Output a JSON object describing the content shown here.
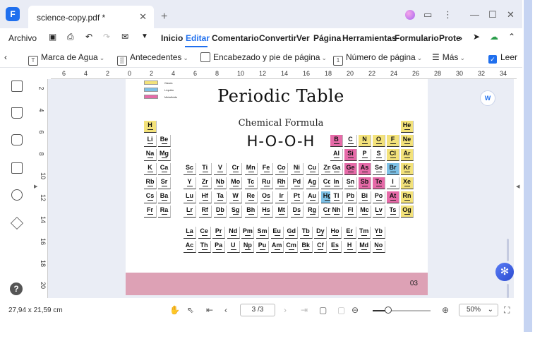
{
  "window": {
    "tab_title": "science-copy.pdf *",
    "close_glyph": "✕",
    "new_tab_glyph": "+",
    "controls": [
      "⋮",
      "—",
      "☐",
      "✕"
    ]
  },
  "menu": {
    "file": "Archivo",
    "items": [
      "Inicio",
      "Editar",
      "Comentario",
      "Convertir",
      "Ver",
      "Página",
      "Herramientas",
      "Formulario",
      "Prote"
    ],
    "active": "Editar",
    "more_glyph": "›"
  },
  "toolbar": {
    "watermark": "Marca de Agua",
    "background": "Antecedentes",
    "header_footer": "Encabezado y pie de página",
    "page_number": "Número de página",
    "more": "Más",
    "read": "Leer",
    "caret": "⌄"
  },
  "ruler": {
    "h_labels": [
      "6",
      "4",
      "2",
      "0",
      "2",
      "4",
      "6",
      "8",
      "10",
      "12",
      "14",
      "16",
      "18",
      "20",
      "22",
      "24",
      "26",
      "28",
      "30",
      "32",
      "34"
    ],
    "v_labels": [
      "2",
      "4",
      "6",
      "8",
      "10",
      "12",
      "14",
      "16",
      "18",
      "20"
    ]
  },
  "document": {
    "legend": [
      {
        "label": "Gases",
        "color": "#f3e27a"
      },
      {
        "label": "Líquido",
        "color": "#7cc0e6"
      },
      {
        "label": "Metalloids",
        "color": "#e66aa8"
      }
    ],
    "title": "Periodic Table",
    "subtitle": "Chemical Formula",
    "formula": "H-O-O-H",
    "page_number": "03",
    "footer_color": "#dda1b5"
  },
  "elements": [
    {
      "s": "H",
      "c": "#f3e27a"
    },
    {
      "s": "He",
      "c": "#f3e27a"
    },
    {
      "s": "Li",
      "c": "#ffffff"
    },
    {
      "s": "Be",
      "c": "#ffffff"
    },
    {
      "s": "B",
      "c": "#e66aa8"
    },
    {
      "s": "C",
      "c": "#ffffff"
    },
    {
      "s": "N",
      "c": "#f3e27a"
    },
    {
      "s": "O",
      "c": "#f3e27a"
    },
    {
      "s": "F",
      "c": "#f3e27a"
    },
    {
      "s": "Ne",
      "c": "#f3e27a"
    },
    {
      "s": "Na",
      "c": "#ffffff"
    },
    {
      "s": "Mg",
      "c": "#ffffff"
    },
    {
      "s": "Al",
      "c": "#ffffff"
    },
    {
      "s": "Si",
      "c": "#e66aa8"
    },
    {
      "s": "P",
      "c": "#ffffff"
    },
    {
      "s": "S",
      "c": "#ffffff"
    },
    {
      "s": "Cl",
      "c": "#f3e27a"
    },
    {
      "s": "Ar",
      "c": "#f3e27a"
    },
    {
      "s": "K",
      "c": "#ffffff"
    },
    {
      "s": "Ca",
      "c": "#ffffff"
    },
    {
      "s": "Sc",
      "c": "#ffffff"
    },
    {
      "s": "Ti",
      "c": "#ffffff"
    },
    {
      "s": "V",
      "c": "#ffffff"
    },
    {
      "s": "Cr",
      "c": "#ffffff"
    },
    {
      "s": "Mn",
      "c": "#ffffff"
    },
    {
      "s": "Fe",
      "c": "#ffffff"
    },
    {
      "s": "Co",
      "c": "#ffffff"
    },
    {
      "s": "Ni",
      "c": "#ffffff"
    },
    {
      "s": "Cu",
      "c": "#ffffff"
    },
    {
      "s": "Zn",
      "c": "#ffffff"
    },
    {
      "s": "Ga",
      "c": "#ffffff"
    },
    {
      "s": "Ge",
      "c": "#e66aa8"
    },
    {
      "s": "As",
      "c": "#e66aa8"
    },
    {
      "s": "Se",
      "c": "#ffffff"
    },
    {
      "s": "Br",
      "c": "#7cc0e6"
    },
    {
      "s": "Kr",
      "c": "#f3e27a"
    },
    {
      "s": "Rb",
      "c": "#ffffff"
    },
    {
      "s": "Sr",
      "c": "#ffffff"
    },
    {
      "s": "Y",
      "c": "#ffffff"
    },
    {
      "s": "Zr",
      "c": "#ffffff"
    },
    {
      "s": "Nb",
      "c": "#ffffff"
    },
    {
      "s": "Mo",
      "c": "#ffffff"
    },
    {
      "s": "Tc",
      "c": "#ffffff"
    },
    {
      "s": "Ru",
      "c": "#ffffff"
    },
    {
      "s": "Rh",
      "c": "#ffffff"
    },
    {
      "s": "Pd",
      "c": "#ffffff"
    },
    {
      "s": "Ag",
      "c": "#ffffff"
    },
    {
      "s": "Cd",
      "c": "#ffffff"
    },
    {
      "s": "In",
      "c": "#ffffff"
    },
    {
      "s": "Sn",
      "c": "#ffffff"
    },
    {
      "s": "Sb",
      "c": "#e66aa8"
    },
    {
      "s": "Te",
      "c": "#e66aa8"
    },
    {
      "s": "I",
      "c": "#ffffff"
    },
    {
      "s": "Xe",
      "c": "#f3e27a"
    },
    {
      "s": "Cs",
      "c": "#ffffff"
    },
    {
      "s": "Ba",
      "c": "#ffffff"
    },
    {
      "s": "Lu",
      "c": "#ffffff"
    },
    {
      "s": "Hf",
      "c": "#ffffff"
    },
    {
      "s": "Ta",
      "c": "#ffffff"
    },
    {
      "s": "W",
      "c": "#ffffff"
    },
    {
      "s": "Re",
      "c": "#ffffff"
    },
    {
      "s": "Os",
      "c": "#ffffff"
    },
    {
      "s": "Ir",
      "c": "#ffffff"
    },
    {
      "s": "Pt",
      "c": "#ffffff"
    },
    {
      "s": "Au",
      "c": "#ffffff"
    },
    {
      "s": "Hg",
      "c": "#7cc0e6"
    },
    {
      "s": "Tl",
      "c": "#ffffff"
    },
    {
      "s": "Pb",
      "c": "#ffffff"
    },
    {
      "s": "Bi",
      "c": "#ffffff"
    },
    {
      "s": "Po",
      "c": "#ffffff"
    },
    {
      "s": "At",
      "c": "#e66aa8"
    },
    {
      "s": "Rn",
      "c": "#f3e27a"
    },
    {
      "s": "Fr",
      "c": "#ffffff"
    },
    {
      "s": "Ra",
      "c": "#ffffff"
    },
    {
      "s": "Lr",
      "c": "#ffffff"
    },
    {
      "s": "Rf",
      "c": "#ffffff"
    },
    {
      "s": "Db",
      "c": "#ffffff"
    },
    {
      "s": "Sg",
      "c": "#ffffff"
    },
    {
      "s": "Bh",
      "c": "#ffffff"
    },
    {
      "s": "Hs",
      "c": "#ffffff"
    },
    {
      "s": "Mt",
      "c": "#ffffff"
    },
    {
      "s": "Ds",
      "c": "#ffffff"
    },
    {
      "s": "Rg",
      "c": "#ffffff"
    },
    {
      "s": "Cn",
      "c": "#ffffff"
    },
    {
      "s": "Nh",
      "c": "#ffffff"
    },
    {
      "s": "Fl",
      "c": "#ffffff"
    },
    {
      "s": "Mc",
      "c": "#ffffff"
    },
    {
      "s": "Lv",
      "c": "#ffffff"
    },
    {
      "s": "Ts",
      "c": "#ffffff"
    },
    {
      "s": "Og",
      "c": "#f3e27a"
    },
    {
      "s": "La",
      "c": "#ffffff"
    },
    {
      "s": "Ce",
      "c": "#ffffff"
    },
    {
      "s": "Pr",
      "c": "#ffffff"
    },
    {
      "s": "Nd",
      "c": "#ffffff"
    },
    {
      "s": "Pm",
      "c": "#ffffff"
    },
    {
      "s": "Sm",
      "c": "#ffffff"
    },
    {
      "s": "Eu",
      "c": "#ffffff"
    },
    {
      "s": "Gd",
      "c": "#ffffff"
    },
    {
      "s": "Tb",
      "c": "#ffffff"
    },
    {
      "s": "Dy",
      "c": "#ffffff"
    },
    {
      "s": "Ho",
      "c": "#ffffff"
    },
    {
      "s": "Er",
      "c": "#ffffff"
    },
    {
      "s": "Tm",
      "c": "#ffffff"
    },
    {
      "s": "Yb",
      "c": "#ffffff"
    },
    {
      "s": "Ac",
      "c": "#ffffff"
    },
    {
      "s": "Th",
      "c": "#ffffff"
    },
    {
      "s": "Pa",
      "c": "#ffffff"
    },
    {
      "s": "U",
      "c": "#ffffff"
    },
    {
      "s": "Np",
      "c": "#ffffff"
    },
    {
      "s": "Pu",
      "c": "#ffffff"
    },
    {
      "s": "Am",
      "c": "#ffffff"
    },
    {
      "s": "Cm",
      "c": "#ffffff"
    },
    {
      "s": "Bk",
      "c": "#ffffff"
    },
    {
      "s": "Cf",
      "c": "#ffffff"
    },
    {
      "s": "Es",
      "c": "#ffffff"
    },
    {
      "s": "H",
      "c": "#ffffff"
    },
    {
      "s": "Md",
      "c": "#ffffff"
    },
    {
      "s": "No",
      "c": "#ffffff"
    }
  ],
  "status": {
    "page_size": "27,94 x 21,59 cm",
    "page_indicator": "3 /3",
    "zoom": "50%",
    "zoom_level_percent": 27,
    "caret": "⌄"
  },
  "colors": {
    "accent": "#1f6fee",
    "canvas": "#eaedf5"
  }
}
